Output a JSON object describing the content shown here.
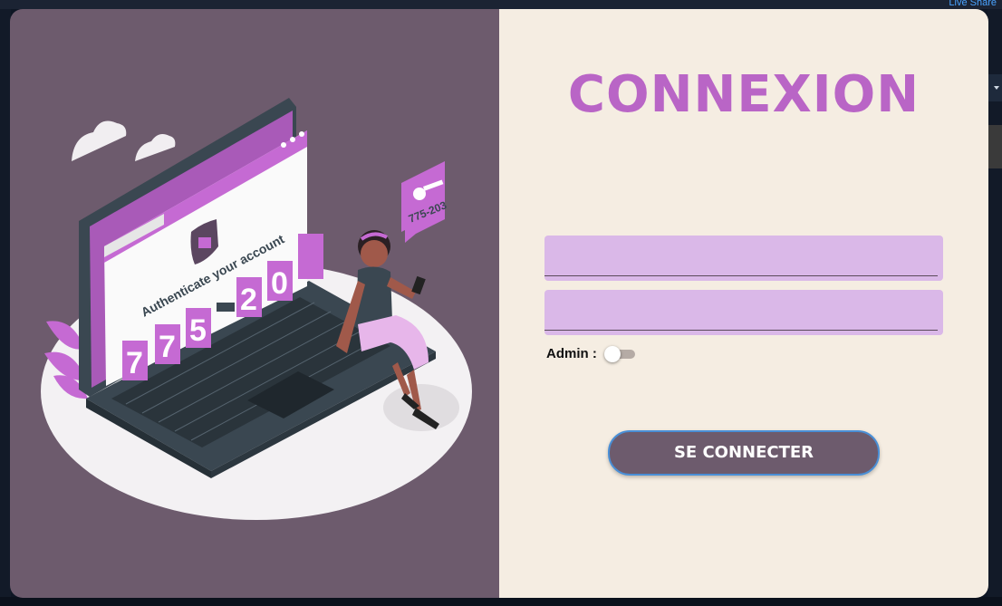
{
  "ide": {
    "live_share": "Live Share"
  },
  "illustration": {
    "screen_heading": "Authenticate your account",
    "code_digits": [
      "7",
      "7",
      "5",
      "-",
      "2",
      "0"
    ],
    "bubble_code": "775-203"
  },
  "login": {
    "title": "CONNEXION",
    "username_value": "",
    "password_value": "",
    "admin_label": "Admin :",
    "admin_toggle_on": false,
    "submit_label": "SE CONNECTER"
  },
  "colors": {
    "panel_left": "#6d5b6d",
    "panel_right": "#f5ede2",
    "accent": "#b965c6",
    "field_bg": "#dab8e8",
    "button_border": "#4a8fd6"
  }
}
